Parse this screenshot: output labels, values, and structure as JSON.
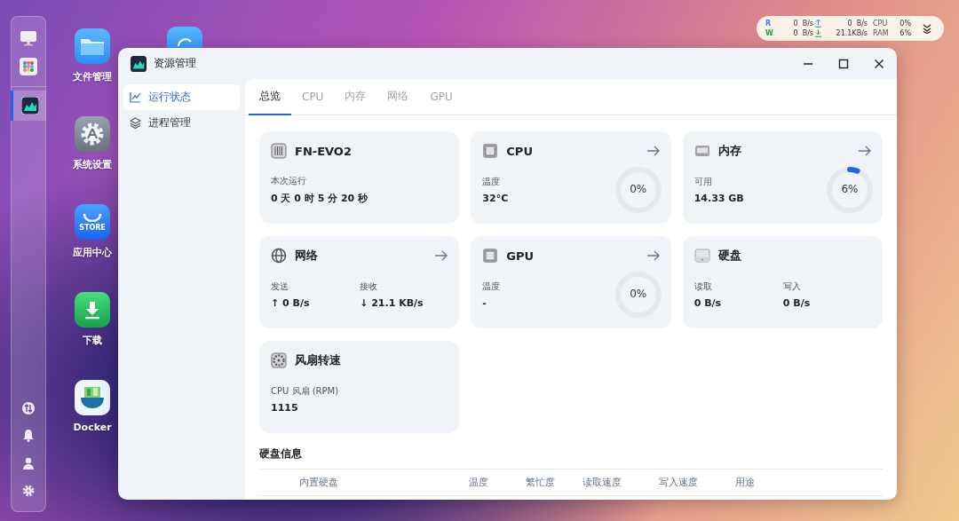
{
  "dock": {
    "items": [
      {
        "kind": "monitor",
        "selected": false
      },
      {
        "kind": "apps",
        "selected": false
      },
      {
        "kind": "resource",
        "selected": true
      }
    ],
    "bottom": [
      {
        "kind": "transfer"
      },
      {
        "kind": "bell"
      },
      {
        "kind": "user"
      },
      {
        "kind": "gear"
      }
    ]
  },
  "desktop_icons": [
    {
      "kind": "folder",
      "label": "文件管理"
    },
    {
      "kind": "settings",
      "label": "系统设置"
    },
    {
      "kind": "store",
      "label": "应用中心",
      "badge": "STORE"
    },
    {
      "kind": "download",
      "label": "下载"
    },
    {
      "kind": "docker",
      "label": "Docker"
    }
  ],
  "status_widget": {
    "rows": [
      {
        "label": "R",
        "disk": "0  B/s",
        "net": "0  B/s",
        "metric": "CPU",
        "value": "0%"
      },
      {
        "label": "W",
        "disk": "0  B/s",
        "net": "21.1KB/s",
        "metric": "RAM",
        "value": "6%"
      }
    ]
  },
  "window": {
    "title": "资源管理"
  },
  "sidebar": {
    "items": [
      {
        "label": "运行状态",
        "selected": true
      },
      {
        "label": "进程管理",
        "selected": false
      }
    ]
  },
  "tabs": [
    {
      "label": "总览",
      "selected": true
    },
    {
      "label": "CPU",
      "selected": false
    },
    {
      "label": "内存",
      "selected": false
    },
    {
      "label": "网络",
      "selected": false
    },
    {
      "label": "GPU",
      "selected": false
    }
  ],
  "cards": [
    {
      "title": "FN-EVO2",
      "arrow": false,
      "stats": [
        {
          "label": "本次运行",
          "value": "0 天 0 时 5 分 20 秒"
        }
      ]
    },
    {
      "title": "CPU",
      "arrow": true,
      "stats": [
        {
          "label": "温度",
          "value": "32°C"
        }
      ],
      "gauge": {
        "level": 0,
        "reading": "0%"
      }
    },
    {
      "title": "内存",
      "arrow": true,
      "stats": [
        {
          "label": "可用",
          "value": "14.33 GB"
        }
      ],
      "gauge": {
        "level": 0.06,
        "reading": "6%"
      }
    },
    {
      "title": "网络",
      "arrow": true,
      "stats": [
        {
          "label": "发送",
          "value": "↑ 0 B/s"
        },
        {
          "label": "接收",
          "value": "↓ 21.1 KB/s"
        }
      ]
    },
    {
      "title": "GPU",
      "arrow": true,
      "stats": [
        {
          "label": "温度",
          "value": "-"
        }
      ],
      "gauge": {
        "level": 0,
        "reading": "0%"
      }
    },
    {
      "title": "硬盘",
      "arrow": false,
      "stats": [
        {
          "label": "读取",
          "value": "0 B/s"
        },
        {
          "label": "写入",
          "value": "0 B/s"
        }
      ]
    },
    {
      "title": "风扇转速",
      "arrow": false,
      "stats": [
        {
          "label": "CPU 风扇 (RPM)",
          "value": "1115"
        }
      ]
    }
  ],
  "disk_info": {
    "title": "硬盘信息",
    "columns": [
      "内置硬盘",
      "温度",
      "繁忙度",
      "读取速度",
      "写入速度",
      "用途"
    ]
  }
}
